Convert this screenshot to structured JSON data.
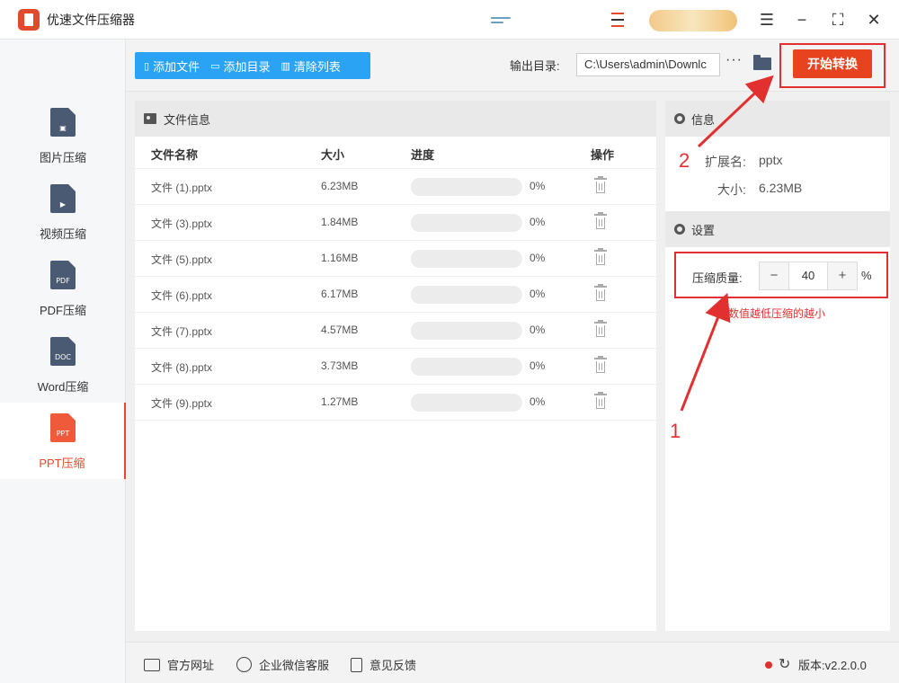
{
  "app": {
    "title": "优速文件压缩器"
  },
  "toolbar": {
    "add_file": "添加文件",
    "add_folder": "添加目录",
    "clear_list": "清除列表",
    "output_label": "输出目录:",
    "output_path": "C:\\Users\\admin\\Downlc",
    "more": "···",
    "start": "开始转换"
  },
  "sidebar": {
    "items": [
      {
        "label": "图片压缩",
        "icon": "image-file-icon",
        "glyph": "▣"
      },
      {
        "label": "视频压缩",
        "icon": "video-file-icon",
        "glyph": "▶"
      },
      {
        "label": "PDF压缩",
        "icon": "pdf-file-icon",
        "glyph": "PDF"
      },
      {
        "label": "Word压缩",
        "icon": "doc-file-icon",
        "glyph": "DOC"
      },
      {
        "label": "PPT压缩",
        "icon": "ppt-file-icon",
        "glyph": "PPT",
        "active": true
      }
    ]
  },
  "file_panel": {
    "title": "文件信息",
    "columns": [
      "文件名称",
      "大小",
      "进度",
      "操作"
    ],
    "rows": [
      {
        "name": "文件 (1).pptx",
        "size": "6.23MB",
        "progress": "0%"
      },
      {
        "name": "文件 (3).pptx",
        "size": "1.84MB",
        "progress": "0%"
      },
      {
        "name": "文件 (5).pptx",
        "size": "1.16MB",
        "progress": "0%"
      },
      {
        "name": "文件 (6).pptx",
        "size": "6.17MB",
        "progress": "0%"
      },
      {
        "name": "文件 (7).pptx",
        "size": "4.57MB",
        "progress": "0%"
      },
      {
        "name": "文件 (8).pptx",
        "size": "3.73MB",
        "progress": "0%"
      },
      {
        "name": "文件 (9).pptx",
        "size": "1.27MB",
        "progress": "0%"
      }
    ]
  },
  "info": {
    "title": "信息",
    "ext_label": "扩展名:",
    "ext_value": "pptx",
    "size_label": "大小:",
    "size_value": "6.23MB"
  },
  "settings": {
    "title": "设置",
    "quality_label": "压缩质量:",
    "quality_value": "40",
    "minus": "−",
    "plus": "+",
    "unit": "%",
    "hint": "数值越低压缩的越小"
  },
  "footer": {
    "website": "官方网址",
    "wechat": "企业微信客服",
    "feedback": "意见反馈",
    "version": "版本:v2.2.0.0"
  },
  "annotations": {
    "step1": "1",
    "step2": "2"
  },
  "colors": {
    "accent": "#2ba3f5",
    "start_button": "#e8431f",
    "annotation": "#e23030"
  }
}
